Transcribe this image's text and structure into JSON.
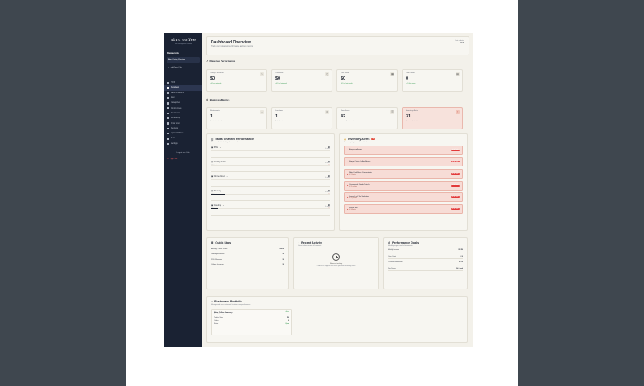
{
  "sidebar": {
    "brand": "abru coffee",
    "brand_sub": "Cafe Management System",
    "section_label": "Restaurants",
    "current_restaurant": {
      "name": "Abru Coffee Roastery",
      "sub": "Food & Beverages"
    },
    "add_restaurant": {
      "label": "Add New Cafe",
      "sub": "Cafe"
    },
    "nav": [
      {
        "label": "POS",
        "active": false
      },
      {
        "label": "Overview",
        "active": true
      },
      {
        "label": "Sales Analytics",
        "active": false
      },
      {
        "label": "Menu",
        "active": false
      },
      {
        "label": "Categories",
        "active": false
      },
      {
        "label": "Dining Areas",
        "active": false
      },
      {
        "label": "Raw Items",
        "active": false
      },
      {
        "label": "Scheduling",
        "active": false
      },
      {
        "label": "Order List",
        "active": false
      },
      {
        "label": "Reviews",
        "active": false
      },
      {
        "label": "Upload Photos",
        "active": false
      },
      {
        "label": "Team",
        "active": false
      },
      {
        "label": "Settings",
        "active": false
      }
    ],
    "logout_label": "Logout of a Cafe",
    "signout_label": "Sign Out"
  },
  "header": {
    "title": "Dashboard Overview",
    "subtitle": "Track your restaurant performance and key metrics",
    "time_label": "Last updated",
    "time_value": "10:21"
  },
  "revenue": {
    "title": "Revenue Performance",
    "cards": [
      {
        "label": "Today's Revenue",
        "value": "$0",
        "note": "+0% vs yesterday",
        "icon": "$"
      },
      {
        "label": "This Week",
        "value": "$0",
        "note": "+0% vs last week",
        "icon": "◷"
      },
      {
        "label": "This Month",
        "value": "$0",
        "note": "+0% vs last month",
        "icon": "▦"
      },
      {
        "label": "Total Orders",
        "value": "0",
        "note": "+0% this month",
        "icon": "▤"
      }
    ]
  },
  "business": {
    "title": "Business Metrics",
    "cards": [
      {
        "label": "Restaurants",
        "value": "1",
        "note": "1 active in network",
        "icon": "⌂",
        "alert": false
      },
      {
        "label": "Locations",
        "value": "1",
        "note": "Active locations",
        "icon": "⊙",
        "alert": false
      },
      {
        "label": "Menu Items",
        "value": "42",
        "note": "Across all restaurants",
        "icon": "☰",
        "alert": false
      },
      {
        "label": "Inventory Alerts",
        "value": "31",
        "note": "Items need attention",
        "icon": "!",
        "alert": true
      }
    ]
  },
  "sales_channels": {
    "title": "Sales Channel Performance",
    "subtitle": "Revenue distribution by sales channels",
    "channels": [
      {
        "name": "POS",
        "value": "$0",
        "orders": "0 orders",
        "share": 0,
        "share_label": "0% of total",
        "change": "0%"
      },
      {
        "name": "Grubby Online",
        "value": "$0",
        "orders": "0 orders",
        "share": 0,
        "share_label": "0% of total",
        "change": "0%"
      },
      {
        "name": "Online Direct",
        "value": "$0",
        "orders": "0 orders",
        "share": 0,
        "share_label": "0% of total",
        "change": "0%"
      },
      {
        "name": "Delivery",
        "value": "$0",
        "orders": "0 orders",
        "share": 0.12,
        "share_label": "0% of total",
        "change": "0%"
      },
      {
        "name": "Catering",
        "value": "$0",
        "orders": "0 orders",
        "share": 0.06,
        "share_label": "0% of total",
        "change": "0%"
      }
    ]
  },
  "inventory": {
    "title": "Inventory Alerts",
    "count": "31",
    "subtitle": "Items requiring immediate attention",
    "items": [
      {
        "name": "Espresso Beans",
        "qty": "0 / 5 packets",
        "status": "Out of Stock"
      },
      {
        "name": "Single Origin Coffee Beans",
        "qty": "0 / 5 packets",
        "status": "Out of Stock"
      },
      {
        "name": "Nitro Cold Brew Concentrate",
        "qty": "0 / 10 units",
        "status": "Out of Stock"
      },
      {
        "name": "Ceremonial Grade Matcha",
        "qty": "0 / 3 packets",
        "status": "Out of Stock"
      },
      {
        "name": "Loose Leaf Tea Selection",
        "qty": "0 / 5 packets",
        "status": "Out of Stock"
      },
      {
        "name": "Whole Milk",
        "qty": "0 / 48 units",
        "status": "Out of Stock"
      }
    ]
  },
  "quick_stats": {
    "title": "Quick Stats",
    "rows": [
      {
        "label": "Average Order Value",
        "value": "$0.00"
      },
      {
        "label": "Grubify Revenue",
        "value": "$0"
      },
      {
        "label": "POS Revenue",
        "value": "$0"
      },
      {
        "label": "Online Revenue",
        "value": "$0"
      }
    ]
  },
  "recent_activity": {
    "title": "Recent Activity",
    "subtitle": "Latest orders across all channels",
    "empty_text": "No recent activity",
    "empty_sub": "Orders will appear here once you start receiving them"
  },
  "goals": {
    "title": "Performance Goals",
    "subtitle": "Monthly targets and achievements",
    "rows": [
      {
        "label": "Monthly Revenue",
        "value": "$0 / $0"
      },
      {
        "label": "Order Count",
        "value": "0 / 0"
      },
      {
        "label": "Customer Satisfaction",
        "value": "0 / 5.0"
      },
      {
        "label": "Data Device",
        "value": "0% / week"
      }
    ]
  },
  "portfolio": {
    "title": "Restaurant Portfolio",
    "subtitle": "Manage and view restaurant locations and performance",
    "card": {
      "name": "Abru Coffee Roastery",
      "type": "Food & Beverages",
      "status": "Active",
      "rows": [
        {
          "label": "Today's Sales",
          "value": "$0",
          "ok": false
        },
        {
          "label": "Orders",
          "value": "0",
          "ok": false
        },
        {
          "label": "Status",
          "value": "Open",
          "ok": true
        }
      ]
    }
  }
}
